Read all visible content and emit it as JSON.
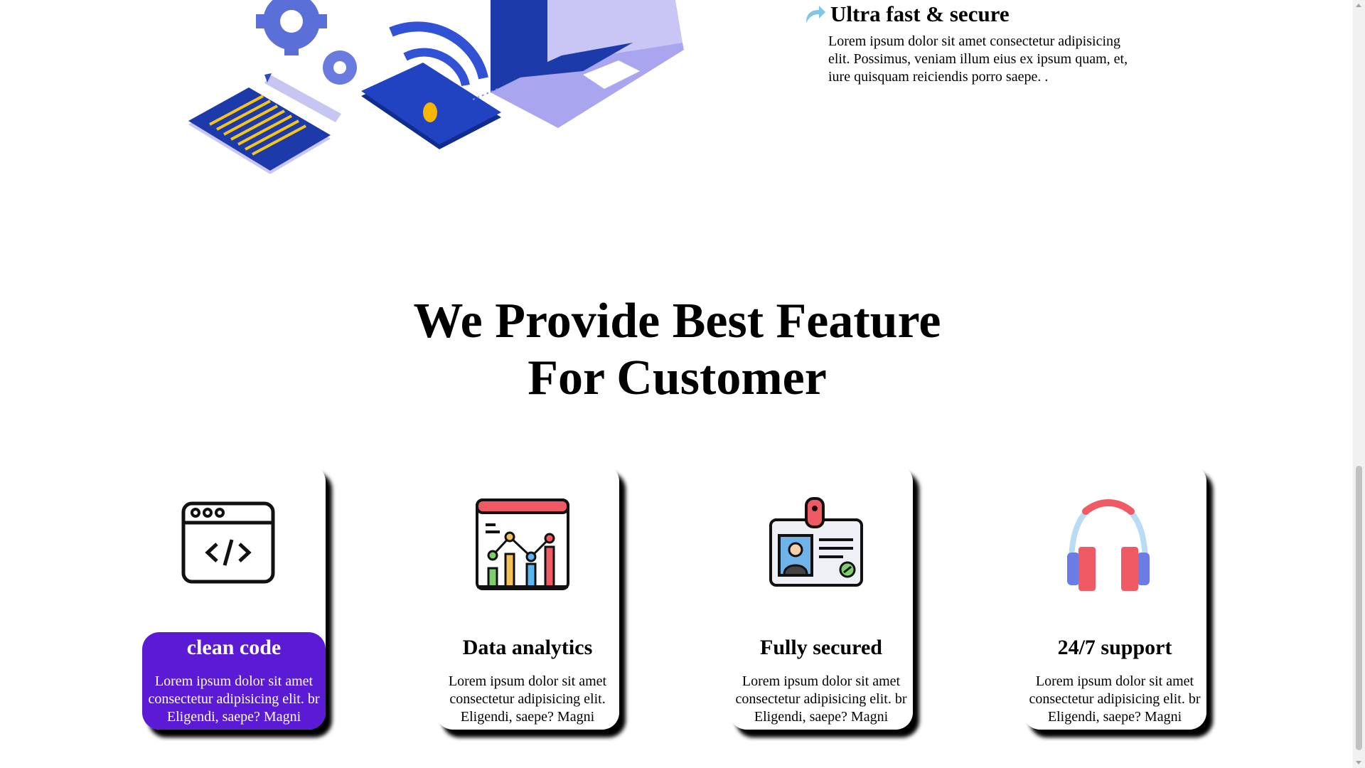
{
  "top_feature": {
    "icon": "curved-arrow-icon",
    "title": "Ultra fast & secure",
    "text": "Lorem ipsum dolor sit amet consectetur adipisicing elit. Possimus, veniam illum eius ex ipsum quam, et, iure quisquam reiciendis porro saepe. ."
  },
  "illustration": {
    "icon": "isometric-devices-illustration"
  },
  "section": {
    "heading_line1": "We Provide Best Feature",
    "heading_line2": "For Customer"
  },
  "cards": [
    {
      "icon": "code-window-icon",
      "title": "clean code",
      "text": "Lorem ipsum dolor sit amet consectetur adipisicing elit. br Eligendi, saepe? Magni",
      "active": true
    },
    {
      "icon": "data-chart-icon",
      "title": "Data analytics",
      "text": "Lorem ipsum dolor sit amet consectetur adipisicing elit. Eligendi, saepe? Magni",
      "active": false
    },
    {
      "icon": "id-card-icon",
      "title": "Fully secured",
      "text": "Lorem ipsum dolor sit amet consectetur adipisicing elit. br Eligendi, saepe? Magni",
      "active": false
    },
    {
      "icon": "headphones-icon",
      "title": "24/7 support",
      "text": "Lorem ipsum dolor sit amet consectetur adipisicing elit. br Eligendi, saepe? Magni",
      "active": false
    }
  ],
  "colors": {
    "active_card": "#5b1bd4",
    "illustration_blue": "#1c3aa9",
    "illustration_lavender": "#a9a6ef",
    "arrow": "#7ec8e3"
  }
}
